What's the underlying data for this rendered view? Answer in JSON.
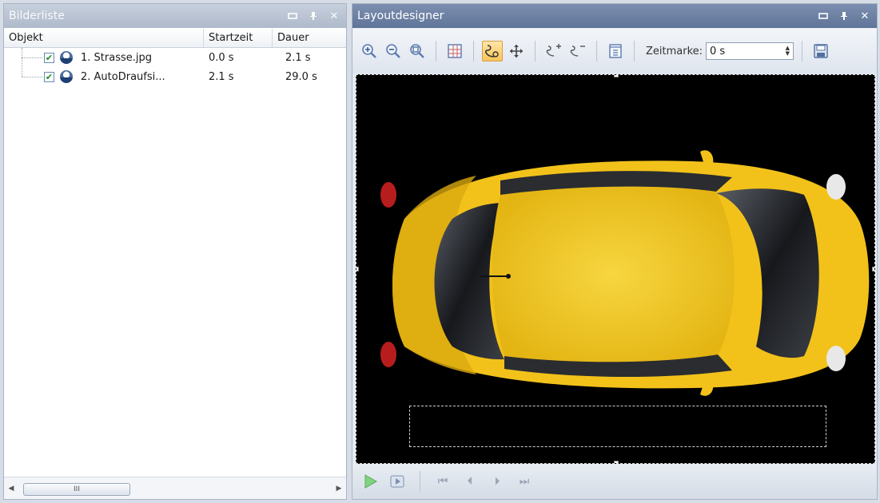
{
  "left_panel": {
    "title": "Bilderliste",
    "columns": {
      "objekt": "Objekt",
      "startzeit": "Startzeit",
      "dauer": "Dauer"
    },
    "items": [
      {
        "name": "1. Strasse.jpg",
        "start": "0.0 s",
        "dauer": "2.1 s",
        "checked": "✔"
      },
      {
        "name": "2. AutoDraufsi...",
        "start": "2.1 s",
        "dauer": "29.0 s",
        "checked": "✔"
      }
    ],
    "scroll": {
      "thumb_glyph": "III",
      "left_arrow": "◀",
      "right_arrow": "▶"
    }
  },
  "right_panel": {
    "title": "Layoutdesigner",
    "toolbar": {
      "zeitmarke_label": "Zeitmarke:",
      "zeitmarke_value": "0 s"
    }
  },
  "colors": {
    "car_body": "#f2c21a",
    "accent": "#f7c45a"
  }
}
